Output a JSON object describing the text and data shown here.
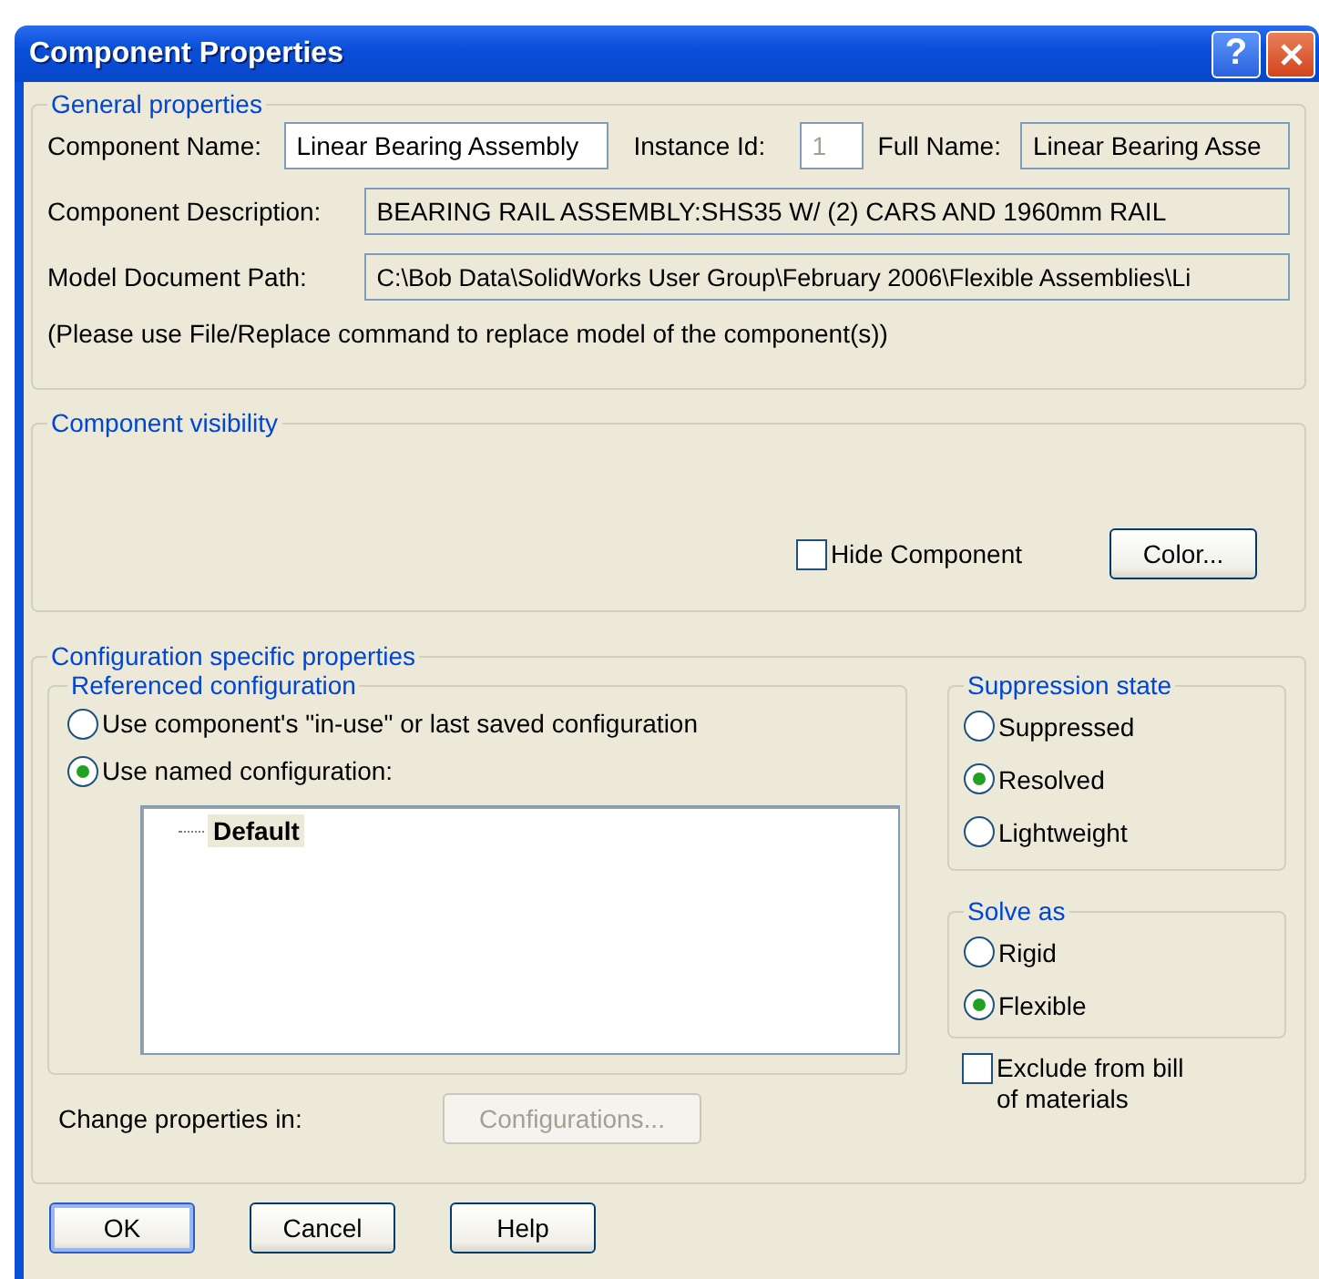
{
  "window": {
    "title": "Component Properties",
    "help": "?"
  },
  "general_properties": {
    "legend": "General properties",
    "component_name": {
      "label": "Component Name:",
      "value": "Linear Bearing Assembly"
    },
    "instance_id": {
      "label": "Instance Id:",
      "value": "1",
      "disabled": true
    },
    "full_name": {
      "label": "Full Name:",
      "value": "Linear Bearing Asse"
    },
    "description": {
      "label": "Component Description:",
      "value": "BEARING RAIL ASSEMBLY:SHS35 W/ (2) CARS AND 1960mm RAIL"
    },
    "path": {
      "label": "Model Document Path:",
      "value": "C:\\Bob Data\\SolidWorks User Group\\February 2006\\Flexible Assemblies\\Li"
    },
    "note": "(Please use File/Replace command to replace model of the component(s))"
  },
  "visibility": {
    "legend": "Component visibility",
    "hide_component": {
      "label": "Hide Component",
      "checked": false
    },
    "color_button": "Color..."
  },
  "configuration": {
    "legend": "Configuration specific properties",
    "referenced": {
      "legend": "Referenced configuration",
      "options": [
        {
          "label": "Use component's \"in-use\" or last saved configuration",
          "selected": false
        },
        {
          "label": "Use named configuration:",
          "selected": true
        }
      ],
      "tree": [
        {
          "label": "Default",
          "selected": true
        }
      ]
    },
    "change_label": "Change properties in:",
    "configurations_button": {
      "label": "Configurations...",
      "disabled": true
    },
    "suppression": {
      "legend": "Suppression state",
      "options": [
        {
          "label": "Suppressed",
          "selected": false
        },
        {
          "label": "Resolved",
          "selected": true
        },
        {
          "label": "Lightweight",
          "selected": false
        }
      ]
    },
    "solve_as": {
      "legend": "Solve as",
      "options": [
        {
          "label": "Rigid",
          "selected": false
        },
        {
          "label": "Flexible",
          "selected": true
        }
      ]
    },
    "exclude": {
      "label": "Exclude from bill of materials",
      "checked": false
    }
  },
  "buttons": [
    {
      "label": "OK",
      "default": true
    },
    {
      "label": "Cancel",
      "default": false
    },
    {
      "label": "Help",
      "default": false
    }
  ]
}
